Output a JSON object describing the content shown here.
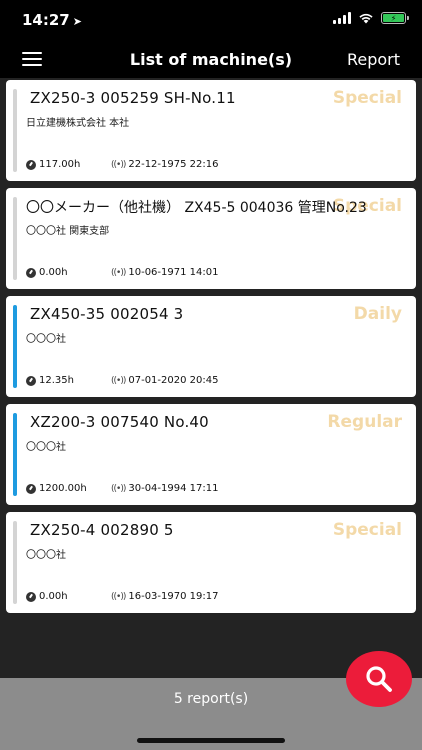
{
  "status": {
    "time": "14:27",
    "battery_label": "⚡"
  },
  "nav": {
    "title": "List of machine(s)",
    "report_label": "Report"
  },
  "machines": [
    {
      "title": "ZX250-3 005259 SH-No.11",
      "company": "日立建機株式会社 本社",
      "badge": "Special",
      "hours": "117.00h",
      "last_comm": "22-12-1975 22:16",
      "bar_color": "#d4d4d4"
    },
    {
      "title": "〇〇メーカー（他社機） ZX45-5 004036 管理No.23",
      "company": "〇〇〇社 関東支部",
      "badge": "Special",
      "hours": "0.00h",
      "last_comm": "10-06-1971 14:01",
      "bar_color": "#d4d4d4"
    },
    {
      "title": "ZX450-35 002054 3",
      "company": "〇〇〇社",
      "badge": "Daily",
      "hours": "12.35h",
      "last_comm": "07-01-2020 20:45",
      "bar_color": "#1e9be0"
    },
    {
      "title": "XZ200-3 007540 No.40",
      "company": "〇〇〇社",
      "badge": "Regular",
      "hours": "1200.00h",
      "last_comm": "30-04-1994 17:11",
      "bar_color": "#1e9be0"
    },
    {
      "title": "ZX250-4 002890 5",
      "company": "〇〇〇社",
      "badge": "Special",
      "hours": "0.00h",
      "last_comm": "16-03-1970 19:17",
      "bar_color": "#d4d4d4"
    }
  ],
  "footer": {
    "report_count": "5 report(s)"
  },
  "icons": {
    "gauge": "gauge-icon",
    "signal": "signal-icon",
    "search": "search-icon",
    "menu": "hamburger-menu-icon"
  },
  "colors": {
    "badge": "#f3d9a8",
    "fab": "#ec1c3a",
    "active_bar": "#1e9be0",
    "inactive_bar": "#d4d4d4"
  }
}
